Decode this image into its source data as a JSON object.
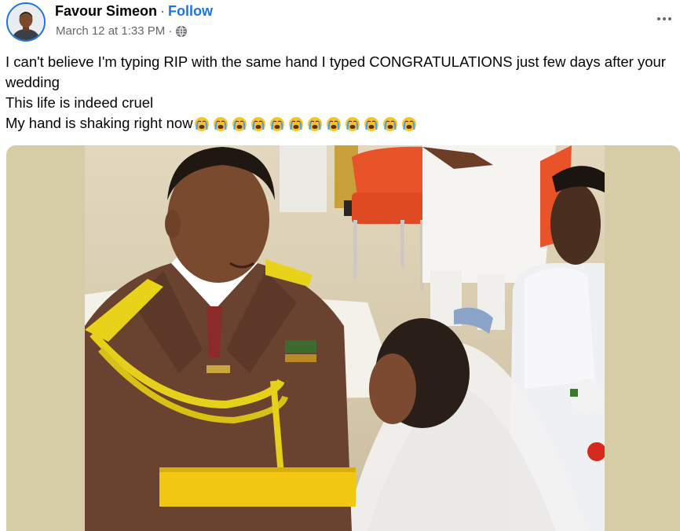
{
  "header": {
    "author_name": "Favour Simeon",
    "separator": "·",
    "follow_label": "Follow",
    "timestamp": "March 12 at 1:33 PM",
    "meta_separator": "·",
    "privacy_icon": "globe-icon",
    "more_icon": "more-options-icon"
  },
  "post": {
    "lines": [
      "I can't believe I'm typing RIP with the same hand I typed CONGRATULATIONS just few days after your wedding",
      "This life is indeed cruel",
      "My hand is shaking right now"
    ],
    "emoji_name": "loudly-crying-face-emoji",
    "emoji_count": 12
  },
  "photo": {
    "subject": "wedding-photo"
  },
  "colors": {
    "link_blue": "#1b74e4",
    "secondary_text": "#65676b",
    "photo_background": "#d6cca5"
  }
}
